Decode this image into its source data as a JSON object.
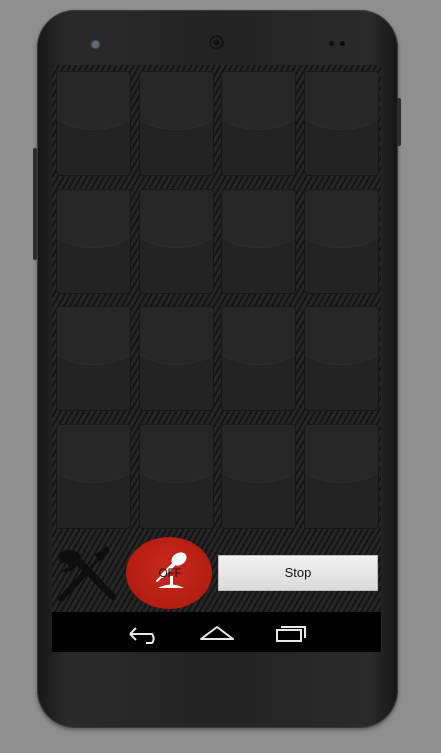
{
  "device": {
    "model": "Nexus 5"
  },
  "pads": [
    {
      "id": 1
    },
    {
      "id": 2
    },
    {
      "id": 3
    },
    {
      "id": 4
    },
    {
      "id": 5
    },
    {
      "id": 6
    },
    {
      "id": 7
    },
    {
      "id": 8
    },
    {
      "id": 9
    },
    {
      "id": 10
    },
    {
      "id": 11
    },
    {
      "id": 12
    },
    {
      "id": 13
    },
    {
      "id": 14
    },
    {
      "id": 15
    },
    {
      "id": 16
    }
  ],
  "controls": {
    "tools_icon": "wrench-screwdriver-icon",
    "record_label": "OFF",
    "record_icon": "microphone-icon",
    "stop_label": "Stop"
  },
  "navbar": {
    "back_icon": "back-arrow-icon",
    "home_icon": "home-icon",
    "recents_icon": "recent-apps-icon"
  },
  "colors": {
    "record_red": "#b51d12",
    "pad": "#232323",
    "stop_button": "#e6e6e6",
    "navbar": "#000000"
  }
}
